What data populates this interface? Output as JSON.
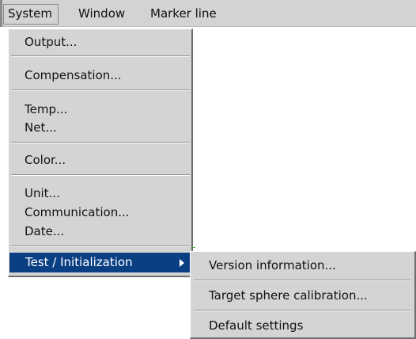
{
  "menubar": {
    "items": [
      {
        "label": "System"
      },
      {
        "label": "Window"
      },
      {
        "label": "Marker line"
      }
    ]
  },
  "system_menu": {
    "items": [
      {
        "label": "Output..."
      },
      {
        "label": "Compensation..."
      },
      {
        "label": "Temp..."
      },
      {
        "label": "Net..."
      },
      {
        "label": "Color..."
      },
      {
        "label": "Unit..."
      },
      {
        "label": "Communication..."
      },
      {
        "label": "Date..."
      },
      {
        "label": "Test / Initialization"
      }
    ]
  },
  "test_submenu": {
    "items": [
      {
        "label": "Version information..."
      },
      {
        "label": "Target sphere calibration..."
      },
      {
        "label": "Default settings"
      }
    ]
  },
  "colors": {
    "menu_bg": "#d4d4d4",
    "highlight": "#0b3f84",
    "highlight_text": "#ffffff"
  },
  "icons": {
    "submenu_arrow": "chevron-right-icon"
  }
}
